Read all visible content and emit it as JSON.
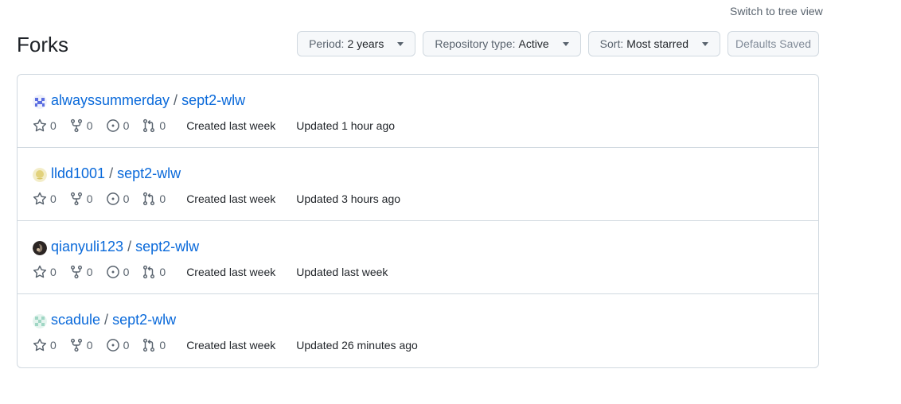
{
  "top_link": {
    "label": "Switch to tree view"
  },
  "header": {
    "title": "Forks"
  },
  "filters": {
    "period": {
      "prefix": "Period:",
      "value": "2 years"
    },
    "repo_type": {
      "prefix": "Repository type:",
      "value": "Active"
    },
    "sort": {
      "prefix": "Sort:",
      "value": "Most starred"
    },
    "defaults_saved": {
      "label": "Defaults Saved"
    }
  },
  "icons": {
    "star": "star-icon",
    "fork": "repo-forked-icon",
    "issue": "issue-opened-icon",
    "pr": "git-pull-request-icon",
    "caret": "triangle-down-icon"
  },
  "colors": {
    "link": "#0969da",
    "muted": "#59636e",
    "border": "#d1d9e0"
  },
  "forks": [
    {
      "owner": "alwayssummerday",
      "repo": "sept2-wlw",
      "avatar_color": "#5b6ee1",
      "stars": "0",
      "forks": "0",
      "issues": "0",
      "pulls": "0",
      "created": "Created last week",
      "updated": "Updated 1 hour ago"
    },
    {
      "owner": "lldd1001",
      "repo": "sept2-wlw",
      "avatar_color": "#e8dc9a",
      "stars": "0",
      "forks": "0",
      "issues": "0",
      "pulls": "0",
      "created": "Created last week",
      "updated": "Updated 3 hours ago"
    },
    {
      "owner": "qianyuli123",
      "repo": "sept2-wlw",
      "avatar_color": "#3a2e2a",
      "stars": "0",
      "forks": "0",
      "issues": "0",
      "pulls": "0",
      "created": "Created last week",
      "updated": "Updated last week"
    },
    {
      "owner": "scadule",
      "repo": "sept2-wlw",
      "avatar_color": "#9fd6c4",
      "stars": "0",
      "forks": "0",
      "issues": "0",
      "pulls": "0",
      "created": "Created last week",
      "updated": "Updated 26 minutes ago"
    }
  ]
}
